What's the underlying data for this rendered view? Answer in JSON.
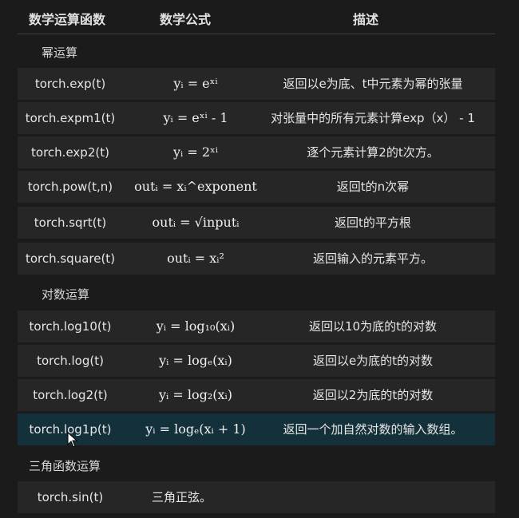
{
  "header": {
    "col1": "数学运算函数",
    "col2": "数学公式",
    "col3": "描述"
  },
  "sections": {
    "exp": "幂运算",
    "log": "对数运算",
    "trig": "三角函数运算"
  },
  "rows": [
    {
      "func": "torch.exp(t)",
      "formula": "yᵢ = eˣⁱ",
      "desc": "返回以e为底、t中元素为幂的张量"
    },
    {
      "func": "torch.expm1(t)",
      "formula": "yᵢ = eˣⁱ - 1",
      "desc": "对张量中的所有元素计算exp（x） - 1"
    },
    {
      "func": "torch.exp2(t)",
      "formula": "yᵢ = 2ˣⁱ",
      "desc": "逐个元素计算2的t次方。"
    },
    {
      "func": "torch.pow(t,n)",
      "formula": "outᵢ = xᵢ^exponent",
      "desc": "返回t的n次幂"
    },
    {
      "func": "torch.sqrt(t)",
      "formula": "outᵢ = √inputᵢ",
      "desc": "返回t的平方根"
    },
    {
      "func": "torch.square(t)",
      "formula": "outᵢ = xᵢ²",
      "desc": "返回输入的元素平方。"
    },
    {
      "func": "torch.log10(t)",
      "formula": "yᵢ = log₁₀(xᵢ)",
      "desc": "返回以10为底的t的对数"
    },
    {
      "func": "torch.log(t)",
      "formula": "yᵢ = logₑ(xᵢ)",
      "desc": "返回以e为底的t的对数"
    },
    {
      "func": "torch.log2(t)",
      "formula": "yᵢ = log₂(xᵢ)",
      "desc": "返回以2为底的t的对数"
    },
    {
      "func": "torch.log1p(t)",
      "formula": "yᵢ = logₑ(xᵢ + 1)",
      "desc": "返回一个加自然对数的输入数组。"
    },
    {
      "func": "torch.sin(t)",
      "formula": "",
      "desc": "三角正弦。"
    }
  ]
}
